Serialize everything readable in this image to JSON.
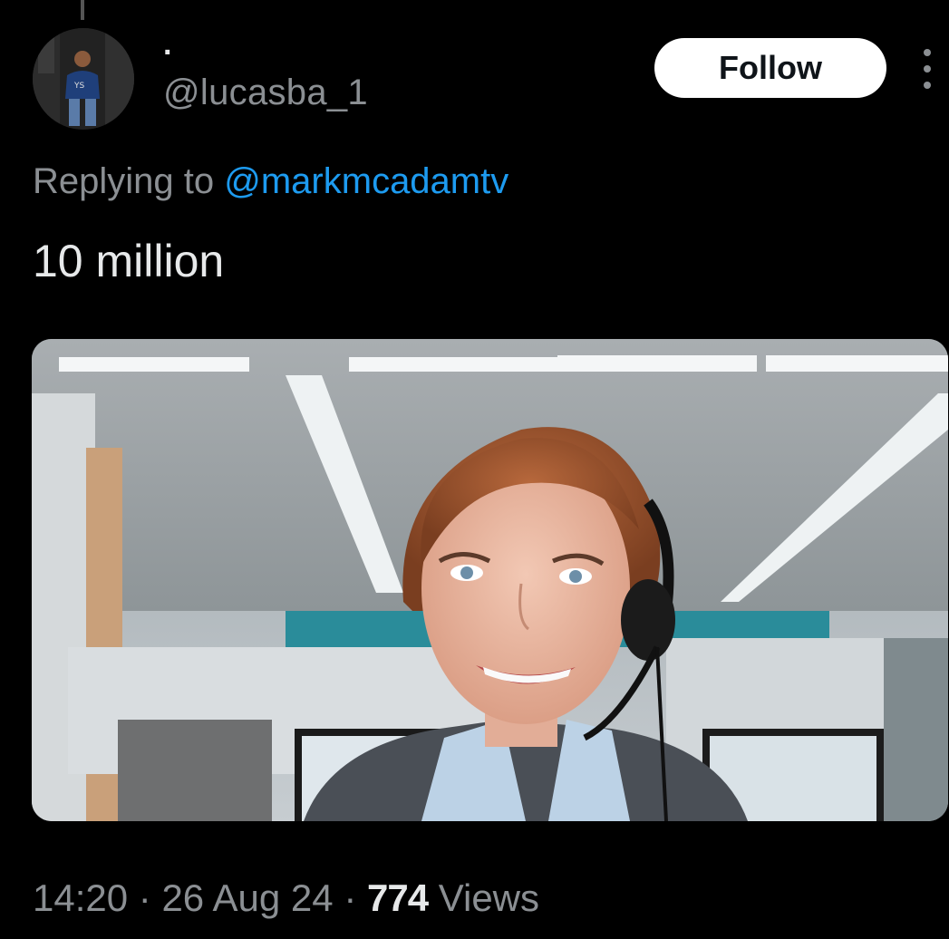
{
  "tweet": {
    "display_name": "·",
    "handle": "@lucasba_1",
    "follow_label": "Follow",
    "replying_to_prefix": "Replying to",
    "replying_to_handle": "@markmcadamtv",
    "text": "10 million",
    "time": "14:20",
    "separator": "·",
    "date": "26 Aug 24",
    "views_count": "774",
    "views_label": "Views"
  },
  "avatar": {
    "shirt_text": "YS"
  },
  "icons": {
    "more": "more-options-icon"
  },
  "colors": {
    "background": "#000000",
    "primary_text": "#e7e9ea",
    "secondary_text": "#8b8f93",
    "link": "#1d9bf0",
    "follow_bg": "#ffffff"
  }
}
